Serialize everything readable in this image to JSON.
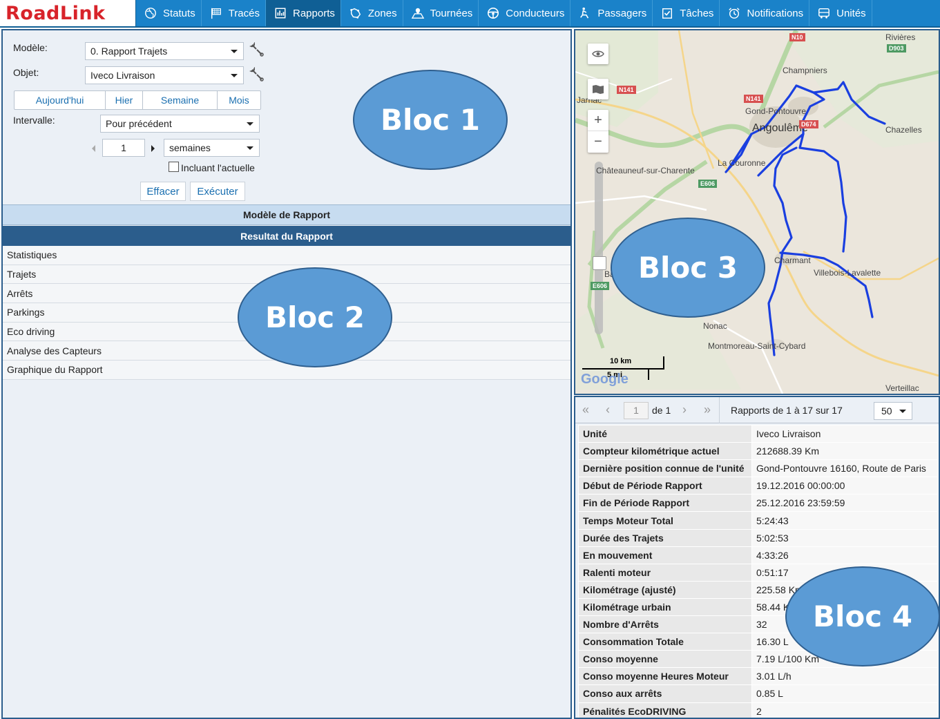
{
  "app": {
    "logo_text": "RoadLink",
    "nav": [
      {
        "label": "Statuts",
        "icon": "globe-icon"
      },
      {
        "label": "Tracés",
        "icon": "flag-icon"
      },
      {
        "label": "Rapports",
        "icon": "report-icon",
        "active": true
      },
      {
        "label": "Zones",
        "icon": "zone-icon"
      },
      {
        "label": "Tournées",
        "icon": "route-map-icon"
      },
      {
        "label": "Conducteurs",
        "icon": "steering-wheel-icon"
      },
      {
        "label": "Passagers",
        "icon": "passenger-icon"
      },
      {
        "label": "Tâches",
        "icon": "task-check-icon"
      },
      {
        "label": "Notifications",
        "icon": "alarm-clock-icon"
      },
      {
        "label": "Unités",
        "icon": "bus-icon"
      }
    ],
    "colors": {
      "nav_bg": "#1a82c9",
      "nav_active": "#0f5f95",
      "panel_border": "#2b5d8c",
      "logo_red": "#d8232a",
      "track_blue": "#1a3fe0"
    }
  },
  "form": {
    "model_label": "Modèle:",
    "model_value": "0. Rapport Trajets",
    "object_label": "Objet:",
    "object_value": "Iveco Livraison",
    "period_buttons": [
      "Aujourd'hui",
      "Hier",
      "Semaine",
      "Mois"
    ],
    "interval_label": "Intervalle:",
    "interval_value": "Pour précédent",
    "count_value": "1",
    "unit_value": "semaines",
    "include_current_label": "Incluant l'actuelle",
    "include_current_checked": false,
    "clear_button": "Effacer",
    "run_button": "Exécuter"
  },
  "sections": {
    "model_bar": "Modèle de Rapport",
    "result_bar": "Resultat du Rapport",
    "items": [
      "Statistiques",
      "Trajets",
      "Arrêts",
      "Parkings",
      "Eco driving",
      "Analyse des Capteurs",
      "Graphique du Rapport"
    ]
  },
  "blocs": [
    "Bloc 1",
    "Bloc 2",
    "Bloc 3",
    "Bloc 4"
  ],
  "map": {
    "labels": [
      "Rivières",
      "Champniers",
      "Gond-Pontouvre",
      "Angoulême",
      "Chazelles",
      "Châteauneuf-sur-Charente",
      "La Couronne",
      "Charmant",
      "Villebois-Lavalette",
      "Nonac",
      "Montmoreau-Saint-Cybard",
      "Verteillac",
      "Baignes",
      "Jarnac"
    ],
    "road_badges": [
      "N10",
      "D903",
      "N141",
      "N141",
      "D674",
      "E606",
      "E606"
    ],
    "scale_km": "10 km",
    "scale_mi": "5 mi",
    "attribution": "Google"
  },
  "pager": {
    "page_value": "1",
    "of_label": "de 1",
    "summary": "Rapports de 1 à 17 sur 17",
    "page_size": "50"
  },
  "stats": [
    {
      "key": "Unité",
      "value": "Iveco Livraison"
    },
    {
      "key": "Compteur kilométrique actuel",
      "value": "212688.39 Km"
    },
    {
      "key": "Dernière position connue de l'unité",
      "value": "Gond-Pontouvre 16160, Route de Paris"
    },
    {
      "key": "Début de Période Rapport",
      "value": "19.12.2016 00:00:00"
    },
    {
      "key": "Fin de Période Rapport",
      "value": "25.12.2016 23:59:59"
    },
    {
      "key": "Temps Moteur Total",
      "value": "5:24:43"
    },
    {
      "key": "Durée des Trajets",
      "value": "5:02:53"
    },
    {
      "key": "En mouvement",
      "value": "4:33:26"
    },
    {
      "key": "Ralenti moteur",
      "value": "0:51:17"
    },
    {
      "key": "Kilométrage (ajusté)",
      "value": "225.58 Km"
    },
    {
      "key": "Kilométrage urbain",
      "value": "58.44 Km"
    },
    {
      "key": "Nombre d'Arrêts",
      "value": "32"
    },
    {
      "key": "Consommation Totale",
      "value": "16.30 L"
    },
    {
      "key": "Conso moyenne",
      "value": "7.19 L/100 Km"
    },
    {
      "key": "Conso moyenne Heures Moteur",
      "value": "3.01 L/h"
    },
    {
      "key": "Conso aux arrêts",
      "value": "0.85 L"
    },
    {
      "key": "Pénalités EcoDRIVING",
      "value": "2"
    }
  ]
}
